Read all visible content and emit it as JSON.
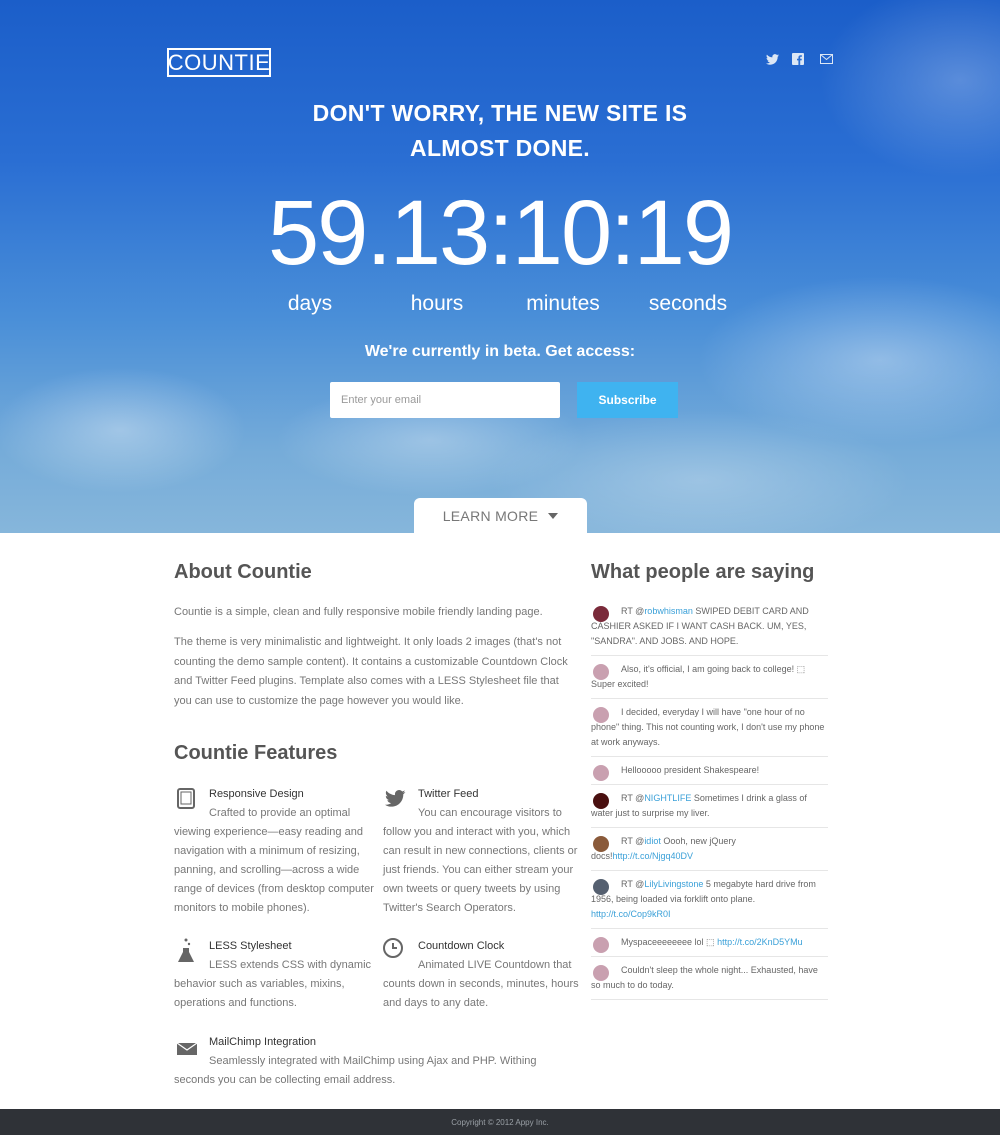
{
  "header": {
    "logo": "COUNTIE",
    "social": [
      {
        "icon": "twitter-icon"
      },
      {
        "icon": "facebook-icon"
      },
      {
        "icon": "mail-icon"
      }
    ]
  },
  "hero": {
    "headline_line1": "DON'T WORRY, THE NEW SITE IS",
    "headline_line2": "ALMOST DONE.",
    "countdown": {
      "days": "59",
      "hours": "13",
      "minutes": "10",
      "seconds": "19",
      "sep1": ".",
      "sep2": ":",
      "sep3": ":",
      "labels": {
        "days": "days",
        "hours": "hours",
        "minutes": "minutes",
        "seconds": "seconds"
      }
    },
    "beta_text": "We're currently in beta. Get access:",
    "email_placeholder": "Enter your email",
    "subscribe_label": "Subscribe",
    "learn_more_label": "LEARN MORE"
  },
  "about": {
    "title": "About Countie",
    "paragraph1": "Countie is a simple, clean and fully responsive mobile friendly landing page.",
    "paragraph2": "The theme is very minimalistic and lightweight. It only loads 2 images (that's not counting the demo sample content). It contains a customizable Countdown Clock and Twitter Feed plugins. Template also comes with a LESS Stylesheet file that you can use to customize the page however you would like."
  },
  "features": {
    "title": "Countie Features",
    "items": [
      {
        "icon": "tablet-icon",
        "title": "Responsive Design",
        "description": "Crafted to provide an optimal viewing experience—easy reading and navigation with a minimum of resizing, panning, and scrolling—across a wide range of devices (from desktop computer monitors to mobile phones)."
      },
      {
        "icon": "twitter-bird-icon",
        "title": "Twitter Feed",
        "description": "You can encourage visitors to follow you and interact with you, which can result in new connections, clients or just friends. You can either stream your own tweets or query tweets by using Twitter's Search Operators."
      },
      {
        "icon": "flask-icon",
        "title": "LESS Stylesheet",
        "description": "LESS extends CSS with dynamic behavior such as variables, mixins, operations and functions."
      },
      {
        "icon": "clock-icon",
        "title": "Countdown Clock",
        "description": "Animated LIVE Countdown that counts down in seconds, minutes, hours and days to any date."
      },
      {
        "icon": "envelope-icon",
        "title": "MailChimp Integration",
        "description": "Seamlessly integrated with MailChimp using Ajax and PHP. Withing seconds you can be collecting email address."
      }
    ]
  },
  "tweets": {
    "title": "What people are saying",
    "items": [
      {
        "prefix": "RT @",
        "link": "robwhisman",
        "text": " SWIPED DEBIT CARD AND CASHIER ASKED IF I WANT CASH BACK. UM, YES, \"SANDRA\". AND JOBS. AND HOPE.",
        "url": "",
        "avatar_color": "#7a2a3a"
      },
      {
        "prefix": "",
        "link": "",
        "text": "Also, it's official, I am going back to college! ⬚ Super excited!",
        "url": "",
        "avatar_color": "#c9a0b0"
      },
      {
        "prefix": "",
        "link": "",
        "text": "I decided, everyday I will have \"one hour of no phone\" thing. This not counting work, I don't use my phone at work anyways.",
        "url": "",
        "avatar_color": "#c9a0b0"
      },
      {
        "prefix": "",
        "link": "",
        "text": "Hellooooo president Shakespeare!",
        "url": "",
        "avatar_color": "#c9a0b0"
      },
      {
        "prefix": "RT @",
        "link": "NIGHTLIFE",
        "text": " Sometimes I drink a glass of water just to surprise my liver.",
        "url": "",
        "avatar_color": "#4a1010"
      },
      {
        "prefix": "RT @",
        "link": "idiot",
        "text": " Oooh, new jQuery docs!",
        "url": "http://t.co/Njgq40DV",
        "avatar_color": "#8a5a3a"
      },
      {
        "prefix": "RT @",
        "link": "LilyLivingstone",
        "text": " 5 megabyte hard drive from 1956, being loaded via forklift onto plane.",
        "url": "http://t.co/Cop9kR0I",
        "avatar_color": "#556070"
      },
      {
        "prefix": "",
        "link": "",
        "text": "Myspaceeeeeeee lol ⬚ ",
        "url": "http://t.co/2KnD5YMu",
        "avatar_color": "#c9a0b0"
      },
      {
        "prefix": "",
        "link": "",
        "text": "Couldn't sleep the whole night... Exhausted, have so much to do today.",
        "url": "",
        "avatar_color": "#c9a0b0"
      }
    ]
  },
  "footer": {
    "copyright": "Copyright © 2012 Appy Inc."
  }
}
